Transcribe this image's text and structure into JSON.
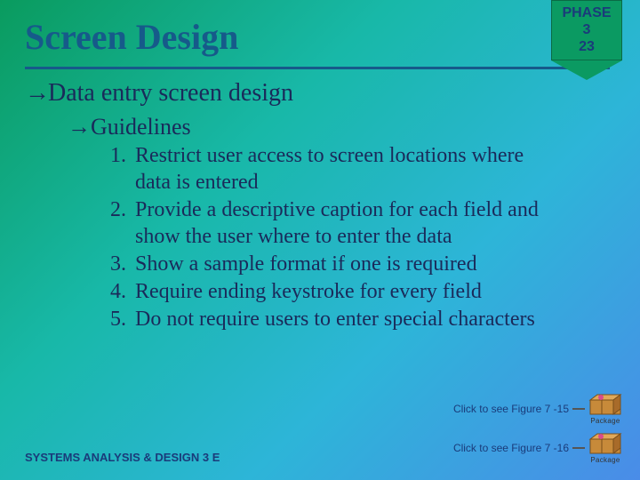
{
  "phase": {
    "line1": "PHASE 3",
    "line2": "23"
  },
  "title": "Screen Design",
  "lvl1": "Data entry screen design",
  "lvl2": "Guidelines",
  "items": [
    "Restrict user access to screen locations where data is entered",
    "Provide a descriptive caption for each field and show the user where to enter the data",
    "Show a sample format if one is required",
    "Require ending keystroke for every field",
    "Do not require users to enter special characters"
  ],
  "footer": "SYSTEMS ANALYSIS & DESIGN 3 E",
  "figlinks": [
    {
      "label": "Click to see Figure 7 -15",
      "pkg": "Package"
    },
    {
      "label": "Click to see Figure 7 -16",
      "pkg": "Package"
    }
  ]
}
